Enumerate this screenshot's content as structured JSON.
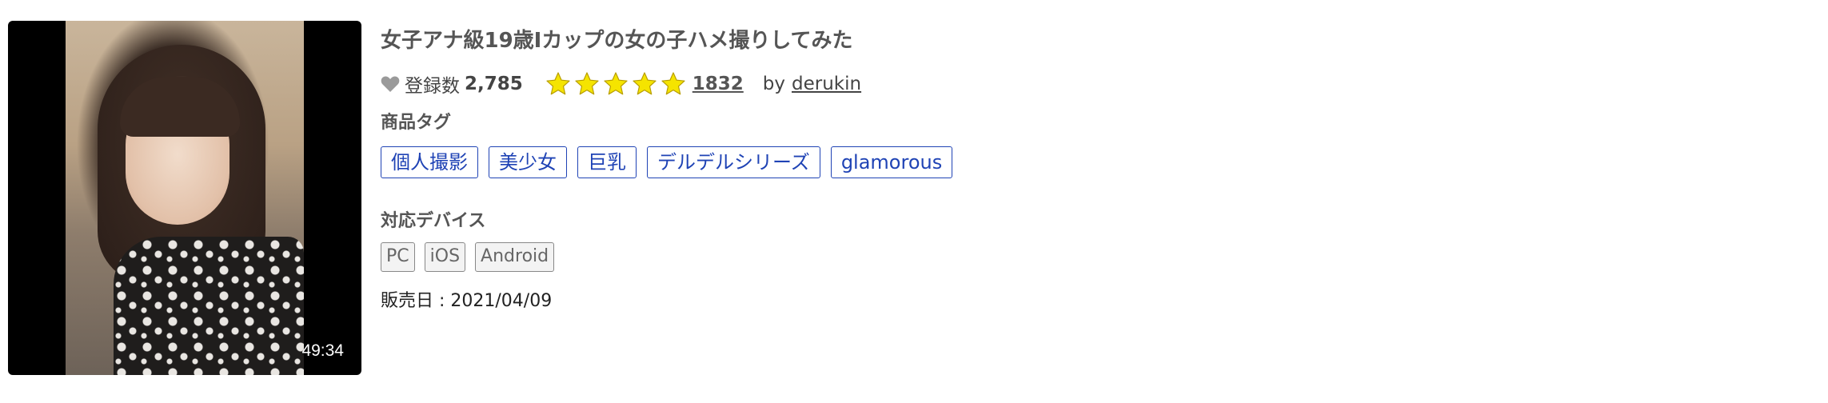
{
  "video": {
    "duration": "49:34",
    "title": "女子アナ級19歳Iカップの女の子ハメ撮りしてみた"
  },
  "favorites": {
    "icon": "heart-icon",
    "label": "登録数",
    "count": "2,785"
  },
  "rating": {
    "stars_filled": 5,
    "star_icon": "star-icon",
    "star_color": "#f5e400",
    "review_count": "1832"
  },
  "author": {
    "by_label": "by",
    "name": "derukin"
  },
  "tags": {
    "label": "商品タグ",
    "items": [
      "個人撮影",
      "美少女",
      "巨乳",
      "デルデルシリーズ",
      "glamorous"
    ],
    "color": "#1f43b5"
  },
  "devices": {
    "label": "対応デバイス",
    "items": [
      "PC",
      "iOS",
      "Android"
    ]
  },
  "release": {
    "text": "販売日 : 2021/04/09"
  }
}
